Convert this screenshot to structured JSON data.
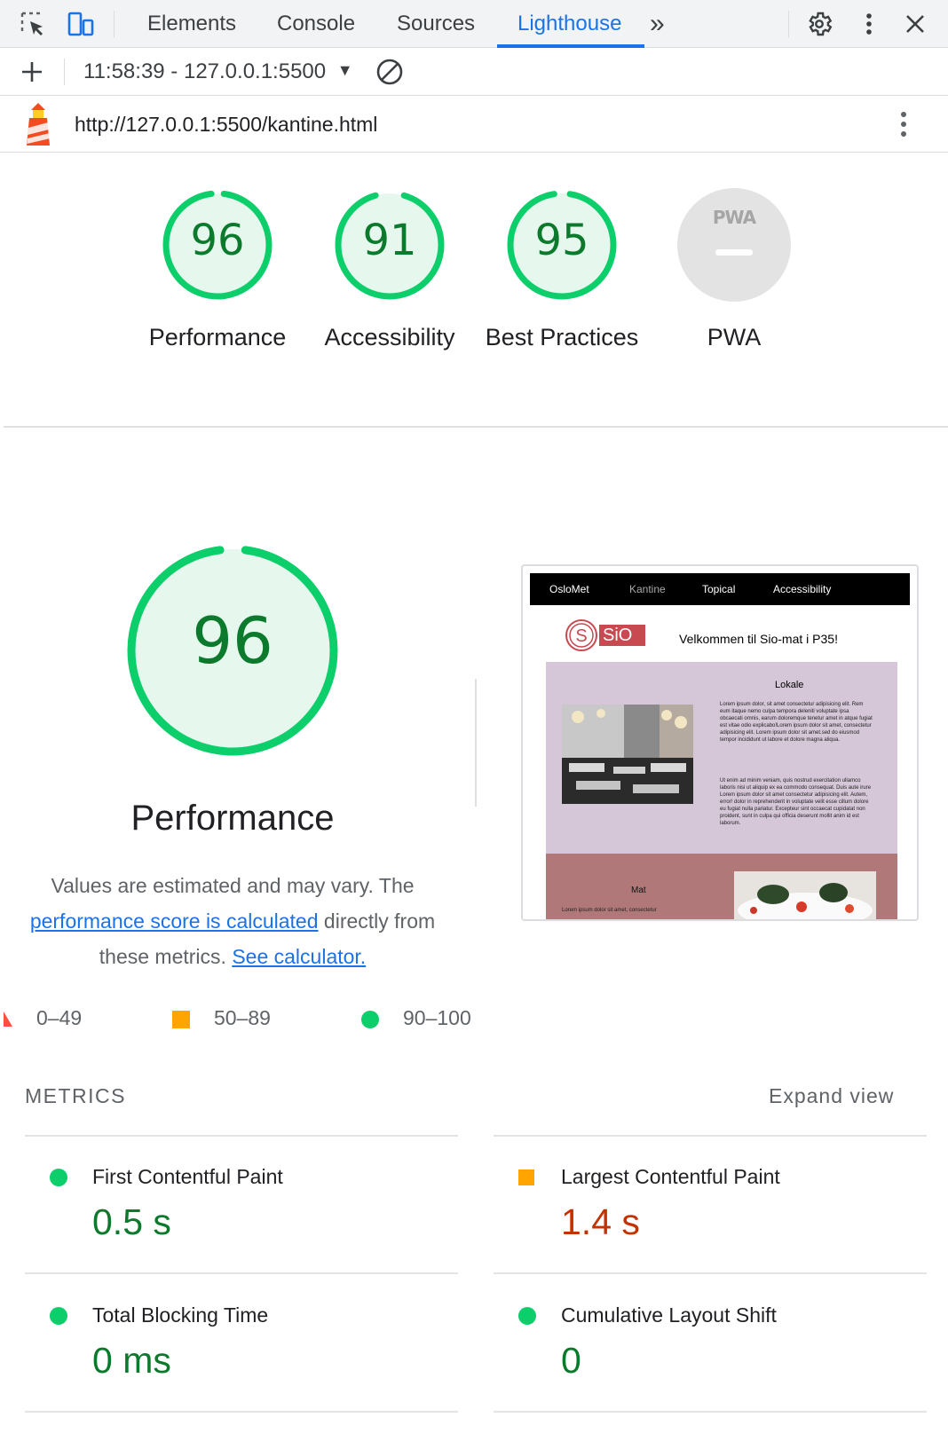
{
  "devtools": {
    "tabs": [
      "Elements",
      "Console",
      "Sources",
      "Lighthouse"
    ],
    "active_tab": "Lighthouse",
    "overflow_label": "»"
  },
  "toolbar": {
    "run_label": "11:58:39 - 127.0.0.1:5500"
  },
  "report": {
    "url": "http://127.0.0.1:5500/kantine.html"
  },
  "categories": [
    {
      "label": "Performance",
      "score": "96",
      "value": 96
    },
    {
      "label": "Accessibility",
      "score": "91",
      "value": 91
    },
    {
      "label": "Best Practices",
      "score": "95",
      "value": 95
    },
    {
      "label": "PWA",
      "score": "–",
      "value": null,
      "badge": "PWA"
    }
  ],
  "performance": {
    "score": "96",
    "value": 96,
    "title": "Performance",
    "desc_prefix": "Values are estimated and may vary. The ",
    "desc_link1": "performance score is calculated",
    "desc_middle": " directly from these metrics. ",
    "desc_link2": "See calculator."
  },
  "legend": [
    {
      "range": "0–49",
      "shape": "triangle",
      "color": "#ff4e42"
    },
    {
      "range": "50–89",
      "shape": "square",
      "color": "#ffa400"
    },
    {
      "range": "90–100",
      "shape": "circle",
      "color": "#0cce6b"
    }
  ],
  "thumbnail": {
    "nav": [
      "OsloMet",
      "Kantine",
      "Topical",
      "Accessibility"
    ],
    "logo_text": "SiO",
    "welcome": "Velkommen til Sio-mat i P35!",
    "section1_title": "Lokale",
    "section1_text1": "Lorem ipsum dolor, sit amet consectetur adipisicing elit. Rem eum itaque nemo culpa tempora deleniti voluptate ipsa obcaecati omnis, earum doloremque tenetur amet in atque fugiat est vitae odio explicabo!Lorem ipsum dolor sit amet, consectetur adipisicing elit. Lorem ipsum dolor sit amet.sed do eiusmod tempor incididunt ut labore et dolore magna aliqua.",
    "section1_text2": "Ut enim ad minim veniam, quis nostrud exercitation ullamco laboris nisi ut aliquip ex ea commodo consequat. Duis aute irure Lorem ipsum dolor sit amet consectetur adipisicing elit. Autem, error! dolor in reprehenderit in voluptate velit esse cillum dolore eu fugiat nulla pariatur. Excepteur sint occaecat cupidatat non proident, sunt in culpa qui officia deserunt mollit anim id est laborum.",
    "section2_title": "Mat",
    "section2_text": "Lorem ipsum dolor sit amet, consectetur"
  },
  "metrics": {
    "heading": "METRICS",
    "expand_label": "Expand view",
    "items": [
      {
        "label": "First Contentful Paint",
        "value": "0.5 s",
        "rating": "pass",
        "color": "#0c7a2c"
      },
      {
        "label": "Largest Contentful Paint",
        "value": "1.4 s",
        "rating": "average",
        "color": "#c33300"
      },
      {
        "label": "Total Blocking Time",
        "value": "0 ms",
        "rating": "pass",
        "color": "#0c7a2c"
      },
      {
        "label": "Cumulative Layout Shift",
        "value": "0",
        "rating": "pass",
        "color": "#0c7a2c"
      }
    ]
  },
  "colors": {
    "pass": "#0cce6b",
    "pass_text": "#0c7a2c",
    "average": "#ffa400",
    "average_text": "#c33300",
    "fail": "#ff4e42",
    "accent": "#1a73e8"
  }
}
